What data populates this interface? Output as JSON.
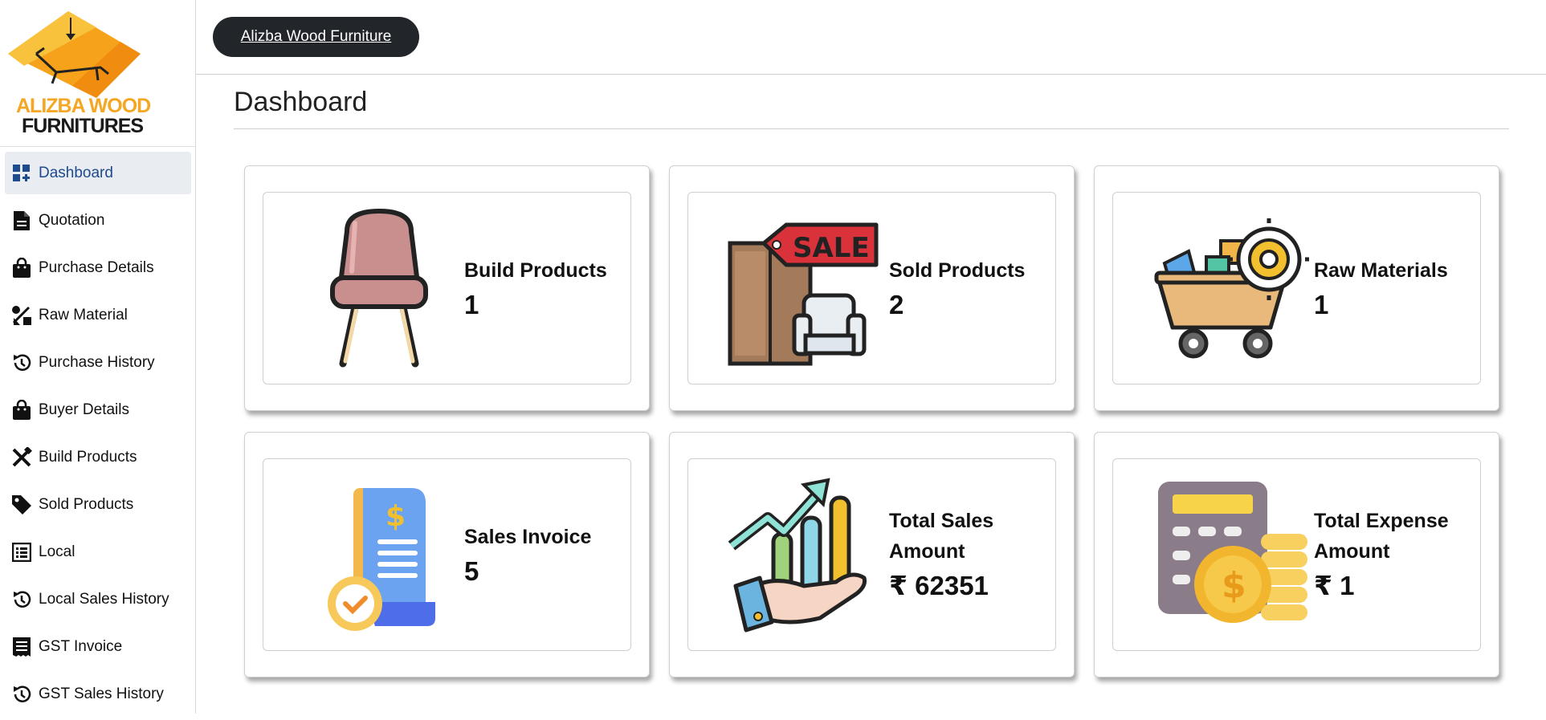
{
  "brand": {
    "pill_label": "Alizba Wood Furniture",
    "logo_line1": "ALIZBA WOOD",
    "logo_line2": "FURNITURES"
  },
  "sidebar": {
    "items": [
      {
        "label": "Dashboard",
        "icon": "dashboard-icon",
        "active": true
      },
      {
        "label": "Quotation",
        "icon": "document-icon"
      },
      {
        "label": "Purchase Details",
        "icon": "shopping-bag-icon"
      },
      {
        "label": "Raw Material",
        "icon": "raw-material-icon"
      },
      {
        "label": "Purchase History",
        "icon": "history-icon"
      },
      {
        "label": "Buyer Details",
        "icon": "shopping-bag-icon"
      },
      {
        "label": "Build Products",
        "icon": "tools-icon"
      },
      {
        "label": "Sold Products",
        "icon": "tag-icon"
      },
      {
        "label": "Local",
        "icon": "list-icon"
      },
      {
        "label": "Local Sales History",
        "icon": "history-icon"
      },
      {
        "label": "GST Invoice",
        "icon": "receipt-icon"
      },
      {
        "label": "GST Sales History",
        "icon": "history-icon"
      }
    ]
  },
  "main": {
    "title": "Dashboard",
    "cards": [
      {
        "label": "Build Products",
        "value": "1",
        "icon": "chair-icon"
      },
      {
        "label": "Sold Products",
        "value": "2",
        "icon": "sale-furniture-icon"
      },
      {
        "label": "Raw Materials",
        "value": "1",
        "icon": "cart-gear-icon"
      },
      {
        "label": "Sales Invoice",
        "value": "5",
        "icon": "invoice-icon"
      },
      {
        "label": "Total Sales Amount",
        "value": "₹ 62351",
        "icon": "growth-chart-icon"
      },
      {
        "label": "Total Expense Amount",
        "value": "₹ 1",
        "icon": "calculator-coins-icon"
      }
    ]
  },
  "colors": {
    "pill_bg": "#22252a",
    "active_nav_bg": "#e9ecf1",
    "active_nav_text": "#1e4a8e",
    "logo_orange": "#f5a623"
  }
}
